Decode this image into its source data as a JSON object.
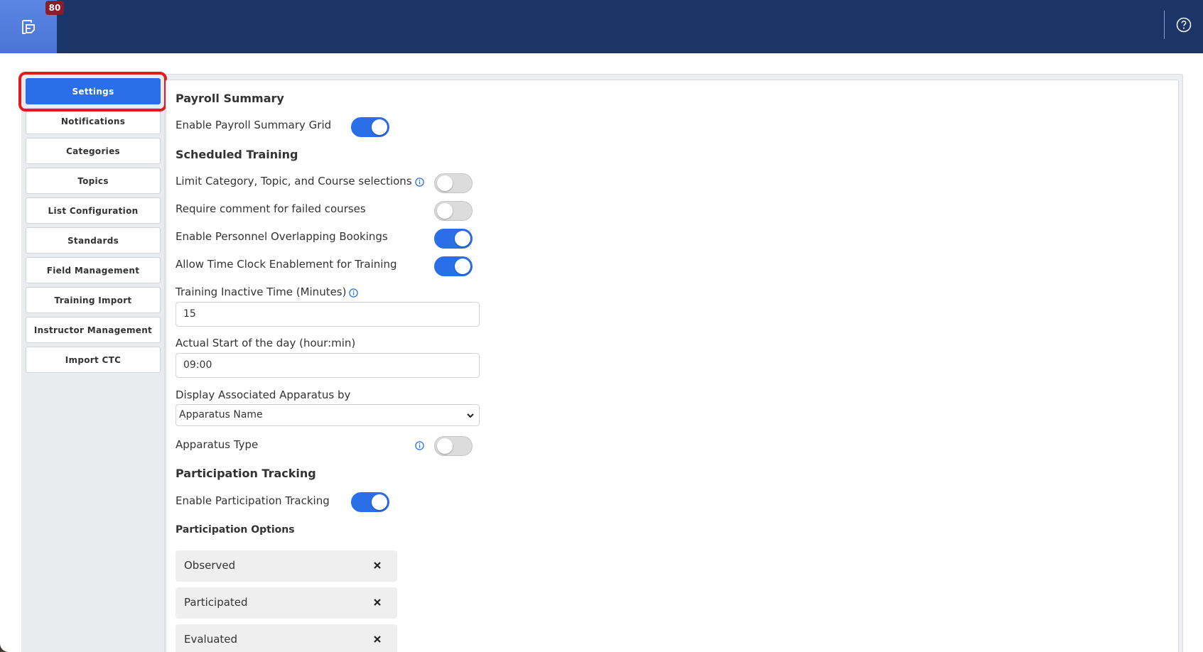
{
  "header": {
    "notification_count": "80"
  },
  "sidebar": {
    "items": [
      {
        "label": "Settings",
        "active": true
      },
      {
        "label": "Notifications"
      },
      {
        "label": "Categories"
      },
      {
        "label": "Topics"
      },
      {
        "label": "List Configuration"
      },
      {
        "label": "Standards"
      },
      {
        "label": "Field Management"
      },
      {
        "label": "Training Import"
      },
      {
        "label": "Instructor Management"
      },
      {
        "label": "Import CTC"
      }
    ]
  },
  "payroll": {
    "heading": "Payroll Summary",
    "enable_grid_label": "Enable Payroll Summary Grid",
    "enable_grid_on": true
  },
  "scheduled": {
    "heading": "Scheduled Training",
    "limit_label": "Limit Category, Topic, and Course selections",
    "limit_on": false,
    "require_comment_label": "Require comment for failed courses",
    "require_comment_on": false,
    "overlap_label": "Enable Personnel Overlapping Bookings",
    "overlap_on": true,
    "timeclock_label": "Allow Time Clock Enablement for Training",
    "timeclock_on": true,
    "inactive_label": "Training Inactive Time (Minutes)",
    "inactive_value": "15",
    "start_label": "Actual Start of the day (hour:min)",
    "start_value": "09:00",
    "apparatus_by_label": "Display Associated Apparatus by",
    "apparatus_by_value": "Apparatus Name",
    "apparatus_type_label": "Apparatus Type",
    "apparatus_type_on": false
  },
  "participation": {
    "heading": "Participation Tracking",
    "enable_label": "Enable Participation Tracking",
    "enable_on": true,
    "options_heading": "Participation Options",
    "options": [
      "Observed",
      "Participated",
      "Evaluated"
    ]
  },
  "colors": {
    "topbar": "#1c3568",
    "accent": "#2b6fe8",
    "highlight": "#e21b23",
    "badge": "#8b1c2c"
  }
}
